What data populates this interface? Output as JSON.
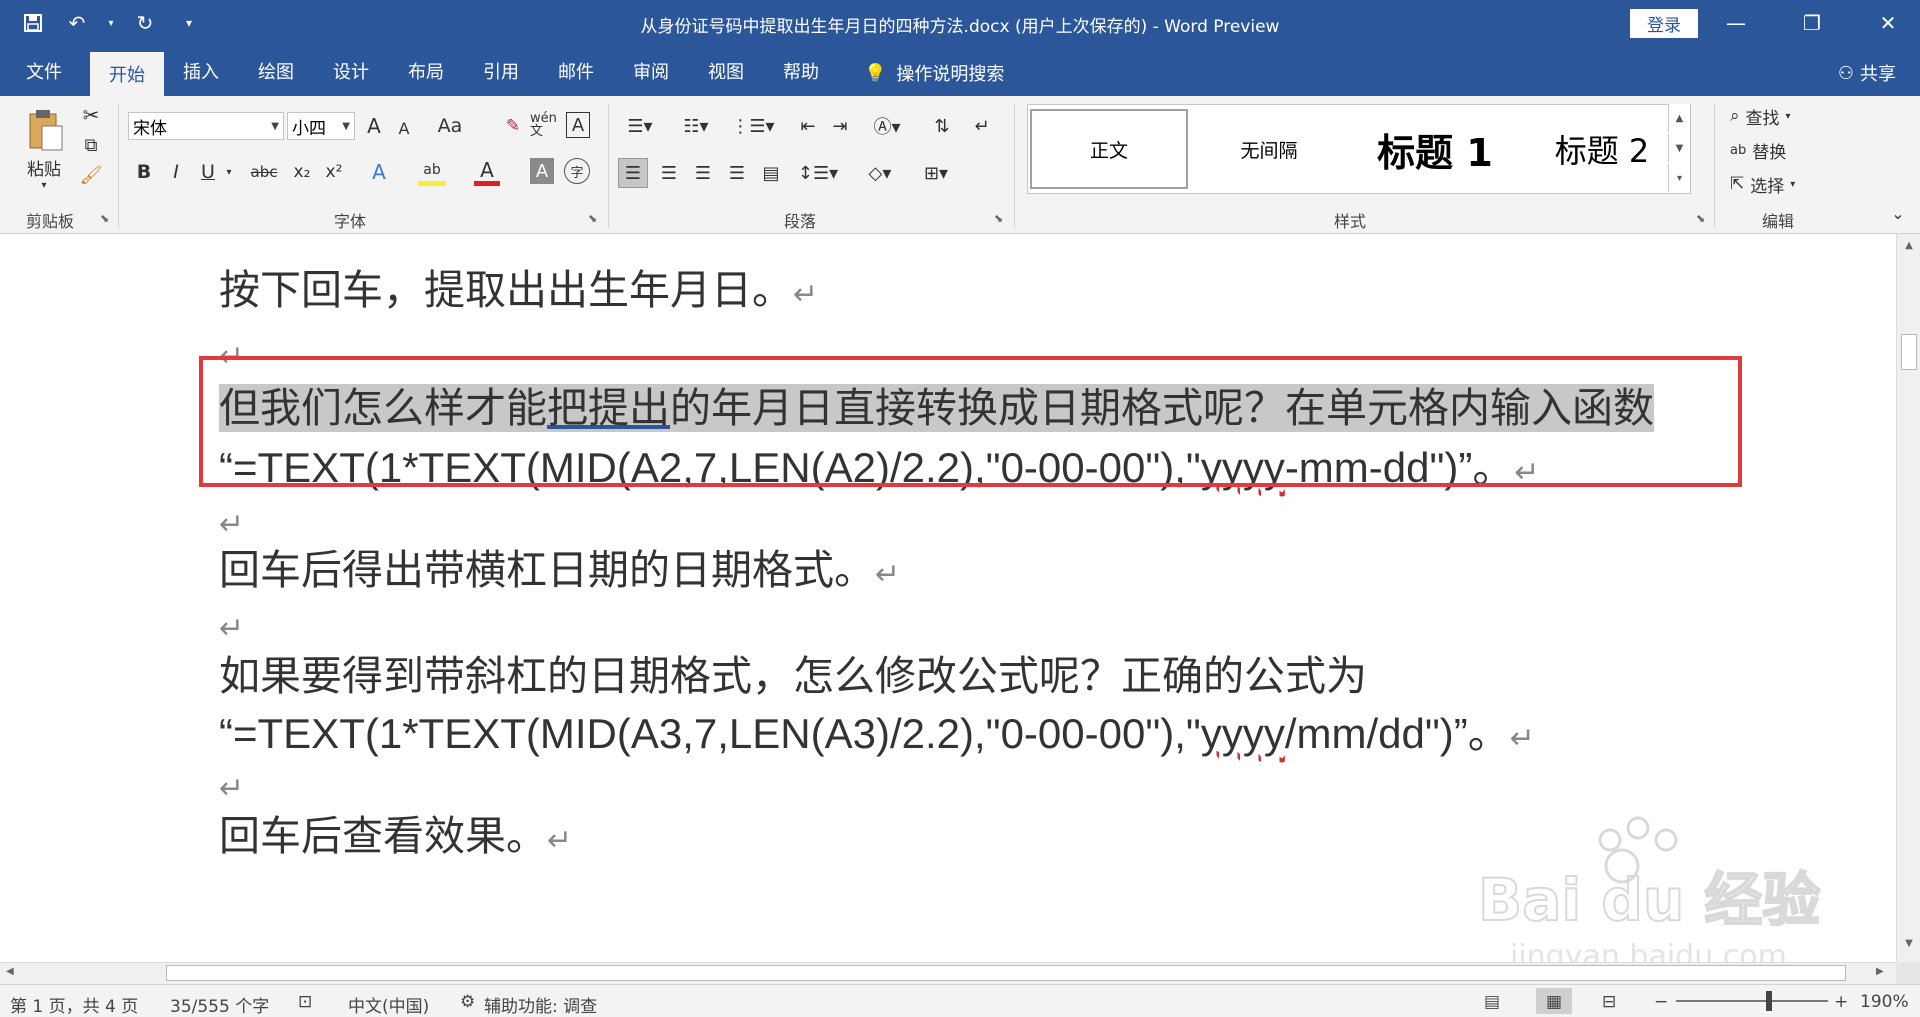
{
  "title_bar": {
    "title": "从身份证号码中提取出生年月日的四种方法.docx (用户上次保存的)  -  Word Preview",
    "login_label": "登录",
    "qat_icons": [
      "save-icon",
      "undo-icon",
      "redo-icon",
      "customize-icon"
    ],
    "window_controls": [
      "minimize-icon",
      "restore-icon",
      "close-icon"
    ]
  },
  "tabs": [
    {
      "label": "文件"
    },
    {
      "label": "开始"
    },
    {
      "label": "插入"
    },
    {
      "label": "绘图"
    },
    {
      "label": "设计"
    },
    {
      "label": "布局"
    },
    {
      "label": "引用"
    },
    {
      "label": "邮件"
    },
    {
      "label": "审阅"
    },
    {
      "label": "视图"
    },
    {
      "label": "帮助"
    }
  ],
  "active_tab": "开始",
  "tell_me": "操作说明搜索",
  "share_label": "共享",
  "ribbon": {
    "clipboard": {
      "paste_label": "粘贴",
      "group_label": "剪贴板"
    },
    "font": {
      "font_name": "宋体",
      "font_size": "小四",
      "group_label": "字体",
      "buttons": {
        "bold": "B",
        "italic": "I",
        "underline": "U",
        "strike": "abc",
        "sub": "x₂",
        "sup": "x²",
        "case": "Aa",
        "grow": "A",
        "shrink": "A",
        "color_a": "A",
        "shade_a": "A",
        "wen": "wén 文",
        "abc_border": "A",
        "enclose": "字"
      }
    },
    "paragraph": {
      "group_label": "段落"
    },
    "styles": {
      "group_label": "样式",
      "items": [
        "正文",
        "无间隔",
        "标题 1",
        "标题 2"
      ]
    },
    "editing": {
      "group_label": "编辑",
      "find": "查找",
      "replace": "替换",
      "select": "选择"
    }
  },
  "document": {
    "paragraphs": [
      {
        "text": "按下回车，提取出出生年月日。"
      },
      {
        "text": ""
      },
      {
        "text_a": "但我们怎么样才能",
        "text_b": "把提出",
        "text_c": "的年月日直接转换成日期格式呢？在单元格内输入函数"
      },
      {
        "text_a": "“=TEXT(1*TEXT(MID(A2,7,LEN(A2)/2.2),\"0-00-00\"),\"",
        "text_b": "yyyy",
        "text_c": "-mm-dd\")”。"
      },
      {
        "text": ""
      },
      {
        "text": "回车后得出带横杠日期的日期格式。"
      },
      {
        "text": ""
      },
      {
        "text": "如果要得到带斜杠的日期格式，怎么修改公式呢？正确的公式为"
      },
      {
        "text_a": "“=TEXT(1*TEXT(MID(A3,7,LEN(A3)/2.2),\"0-00-00\"),\"",
        "text_b": "yyyy",
        "text_c": "/mm/dd\")”。"
      },
      {
        "text": ""
      },
      {
        "text": "回车后查看效果。"
      }
    ],
    "return_mark": "↵"
  },
  "status_bar": {
    "page": "第 1 页，共 4 页",
    "words": "35/555 个字",
    "language": "中文(中国)",
    "accessibility": "辅助功能: 调查",
    "zoom": "190%",
    "zoom_level_percent": 190
  },
  "watermark": {
    "brand": "Bai du 经验",
    "url": "jingyan.baidu.com"
  },
  "colors": {
    "accent": "#2b579a",
    "highlight_box": "#e03a3e",
    "selection": "#c8c8c8"
  }
}
